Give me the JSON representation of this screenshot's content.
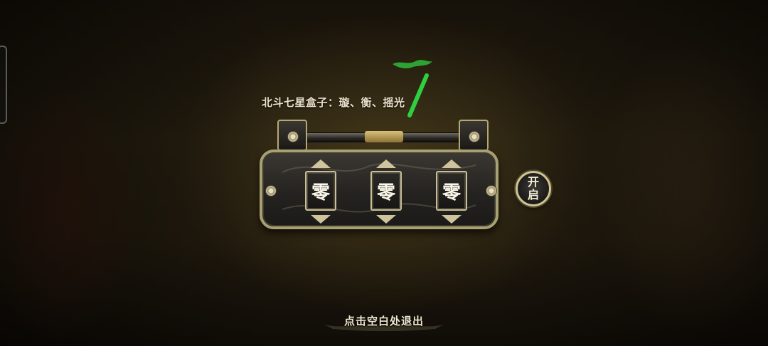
{
  "hint": {
    "text": "北斗七星盒子：璇、衡、摇光"
  },
  "lock": {
    "dials": [
      {
        "value": "零"
      },
      {
        "value": "零"
      },
      {
        "value": "零"
      }
    ]
  },
  "open_button": {
    "label": "开启"
  },
  "exit_hint": {
    "text": "点击空白处退出"
  },
  "colors": {
    "accent_gold": "#c9bf98",
    "green_ink": "#2fc83a",
    "text_light": "#e9dfc9"
  }
}
